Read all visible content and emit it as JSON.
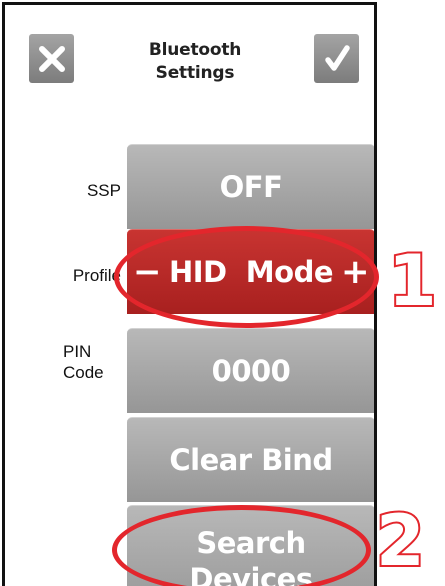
{
  "header": {
    "close_icon": "close-icon",
    "confirm_icon": "checkmark-icon",
    "title": "Bluetooth\nSettings"
  },
  "rows": {
    "ssp": {
      "label": "SSP",
      "value": "OFF"
    },
    "profile": {
      "label": "Profile",
      "value": "HID  Mode",
      "minus": "−",
      "plus": "+"
    },
    "pin": {
      "label": "PIN\nCode",
      "value": "0000"
    }
  },
  "buttons": {
    "clear_bind": "Clear Bind",
    "search_devices": "Search\nDevices"
  },
  "annotations": {
    "callout_1": "1",
    "callout_2": "2"
  },
  "colors": {
    "tile_gray": "#a8a8a8",
    "tile_red": "#b82a28",
    "annotation_red": "#e3262c",
    "icon_gray": "#8c8c8c"
  }
}
